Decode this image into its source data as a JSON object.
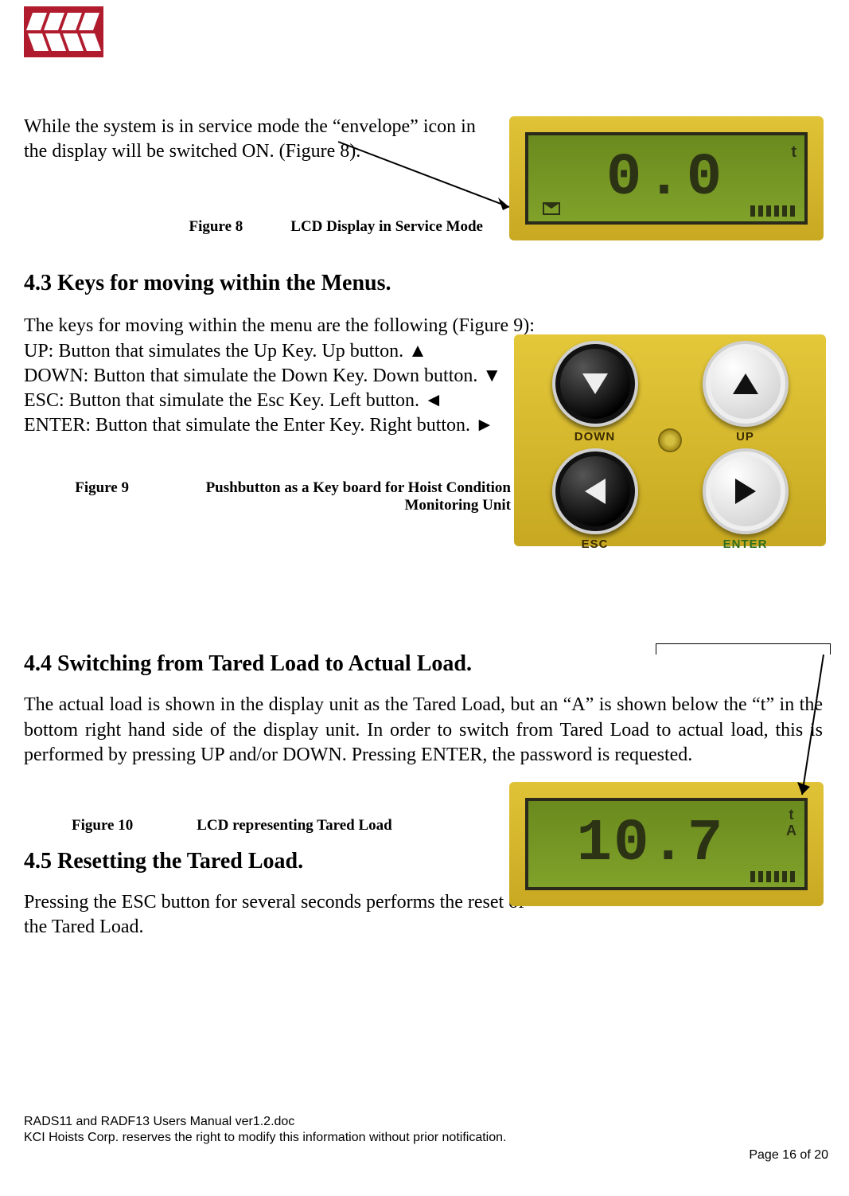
{
  "intro_para": "While the system is in service mode the “envelope” icon in the display will be switched ON. (Figure 8).",
  "fig8": {
    "num": "Figure 8",
    "text": "LCD Display in Service Mode"
  },
  "sec43": {
    "heading": "4.3  Keys for moving within the Menus.",
    "line0": "The keys for moving within the menu are the following (Figure 9):",
    "line1": "UP: Button that simulates the Up Key. Up button. ▲",
    "line2": "DOWN: Button that simulate the Down Key. Down button. ▼",
    "line3": "ESC: Button that simulate the Esc Key. Left button. ◄",
    "line4": "ENTER: Button that simulate the Enter Key. Right button. ►"
  },
  "fig9": {
    "num": "Figure 9",
    "text": "Pushbutton as a Key board for Hoist Condition Monitoring Unit"
  },
  "sec44": {
    "heading": "4.4  Switching from Tared Load to Actual Load.",
    "para": "The actual load is shown in the display unit as the Tared Load, but an “A” is shown below the “t” in the bottom right hand side of the display unit. In order to switch from Tared Load to actual load, this is performed by pressing UP and/or DOWN. Pressing ENTER, the password is requested."
  },
  "fig10": {
    "num": "Figure 10",
    "text": "LCD representing Tared Load"
  },
  "sec45": {
    "heading": "4.5  Resetting the Tared Load.",
    "para": "Pressing the ESC button for several seconds performs the reset of the Tared Load."
  },
  "lcd1": {
    "value": "0.0",
    "unit": "t"
  },
  "lcd2": {
    "value": "10.7",
    "unit_top": "t",
    "unit_bottom": "A"
  },
  "buttons": {
    "down": "DOWN",
    "up": "UP",
    "esc": "ESC",
    "enter": "ENTER"
  },
  "footer1": "RADS11 and RADF13 Users Manual ver1.2.doc",
  "footer2": "KCI Hoists Corp.  reserves the right to modify this information without prior notification.",
  "pagenum": "Page 16 of 20"
}
